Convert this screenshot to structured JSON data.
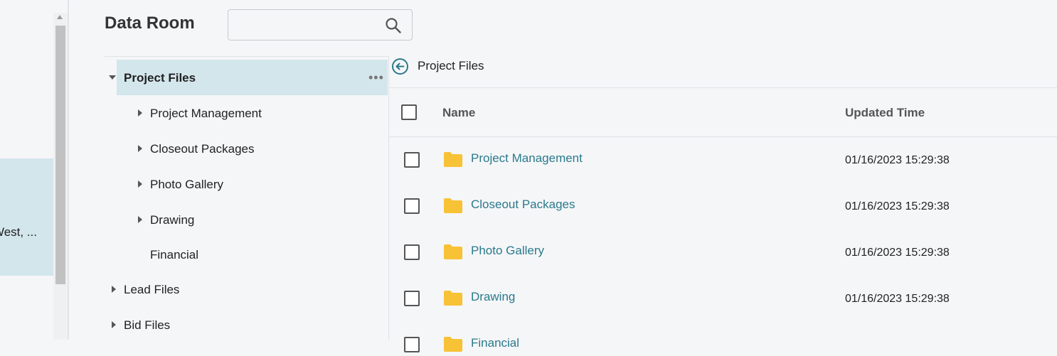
{
  "left_pane": {
    "item_text": "West, ..."
  },
  "header": {
    "title": "Data Room",
    "search_value": "",
    "search_placeholder": ""
  },
  "tree": {
    "root": {
      "label": "Project Files",
      "more_label": "•••"
    },
    "children": [
      {
        "label": "Project Management",
        "has_children": true
      },
      {
        "label": "Closeout Packages",
        "has_children": true
      },
      {
        "label": "Photo Gallery",
        "has_children": true
      },
      {
        "label": "Drawing",
        "has_children": true
      },
      {
        "label": "Financial",
        "has_children": false
      }
    ],
    "siblings": [
      {
        "label": "Lead Files",
        "has_children": true
      },
      {
        "label": "Bid Files",
        "has_children": true
      }
    ]
  },
  "list": {
    "breadcrumb": "Project Files",
    "columns": {
      "name": "Name",
      "updated": "Updated Time"
    },
    "rows": [
      {
        "name": "Project Management",
        "updated": "01/16/2023 15:29:38"
      },
      {
        "name": "Closeout Packages",
        "updated": "01/16/2023 15:29:38"
      },
      {
        "name": "Photo Gallery",
        "updated": "01/16/2023 15:29:38"
      },
      {
        "name": "Drawing",
        "updated": "01/16/2023 15:29:38"
      },
      {
        "name": "Financial",
        "updated": ""
      }
    ]
  },
  "colors": {
    "accent": "#2a7a8c",
    "selection": "#d3e6ec",
    "folder": "#f7c235"
  }
}
